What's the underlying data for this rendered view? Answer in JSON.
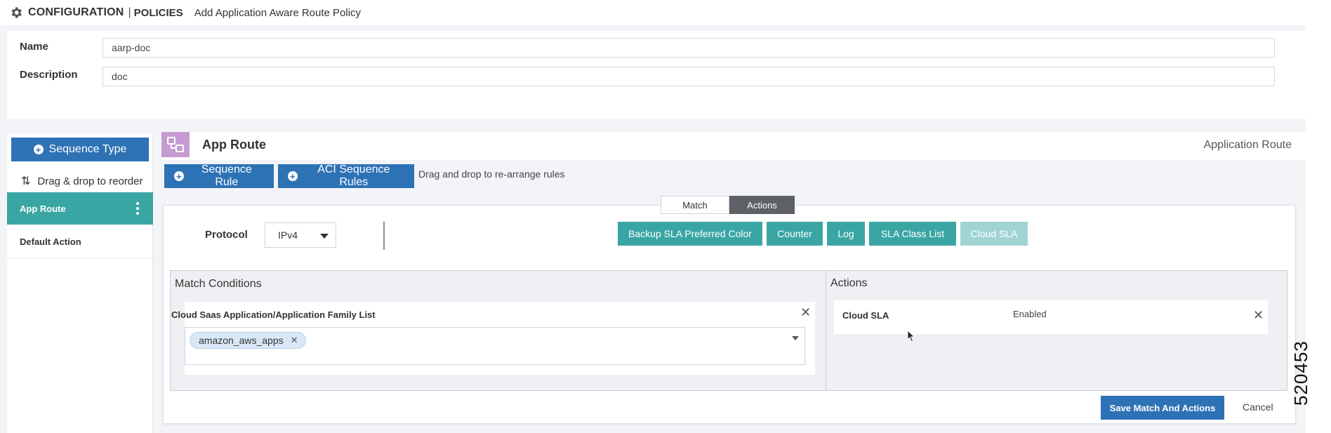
{
  "header": {
    "title": "CONFIGURATION",
    "separator": "|",
    "section": "POLICIES",
    "subtitle": "Add Application Aware Route Policy"
  },
  "form": {
    "name_label": "Name",
    "name_value": "aarp-doc",
    "description_label": "Description",
    "description_value": "doc"
  },
  "sidebar": {
    "sequence_type_label": "Sequence Type",
    "drag_hint": "Drag & drop to reorder",
    "items": [
      {
        "label": "App Route",
        "active": true
      },
      {
        "label": "Default Action",
        "active": false
      }
    ]
  },
  "main": {
    "title": "App Route",
    "type_label": "Application Route",
    "sequence_rule_label": "Sequence Rule",
    "aci_rules_label": "ACI Sequence Rules",
    "drag_hint": "Drag and drop to re-arrange rules",
    "tabs": [
      {
        "label": "Match",
        "active": false
      },
      {
        "label": "Actions",
        "active": true
      }
    ],
    "protocol_label": "Protocol",
    "protocol_value": "IPv4",
    "action_buttons": [
      {
        "label": "Backup SLA Preferred Color",
        "disabled": false
      },
      {
        "label": "Counter",
        "disabled": false
      },
      {
        "label": "Log",
        "disabled": false
      },
      {
        "label": "SLA Class List",
        "disabled": false
      },
      {
        "label": "Cloud SLA",
        "disabled": true
      }
    ],
    "match_conditions_heading": "Match Conditions",
    "condition": {
      "title": "Cloud Saas Application/Application Family List",
      "tags": [
        "amazon_aws_apps"
      ]
    },
    "actions_heading": "Actions",
    "action_entry": {
      "name": "Cloud SLA",
      "value": "Enabled"
    },
    "save_label": "Save Match And Actions",
    "cancel_label": "Cancel"
  },
  "figure_id": "520453",
  "colors": {
    "primary_blue": "#2e72b6",
    "teal": "#3aa6a4",
    "teal_disabled": "#9fd4d3",
    "dark_tab": "#5e6166",
    "route_icon": "#c59bd2"
  },
  "icons": {
    "header": "gear-icon",
    "drag": "updown-arrows-icon",
    "route": "app-route-icon",
    "close": "close-icon"
  }
}
